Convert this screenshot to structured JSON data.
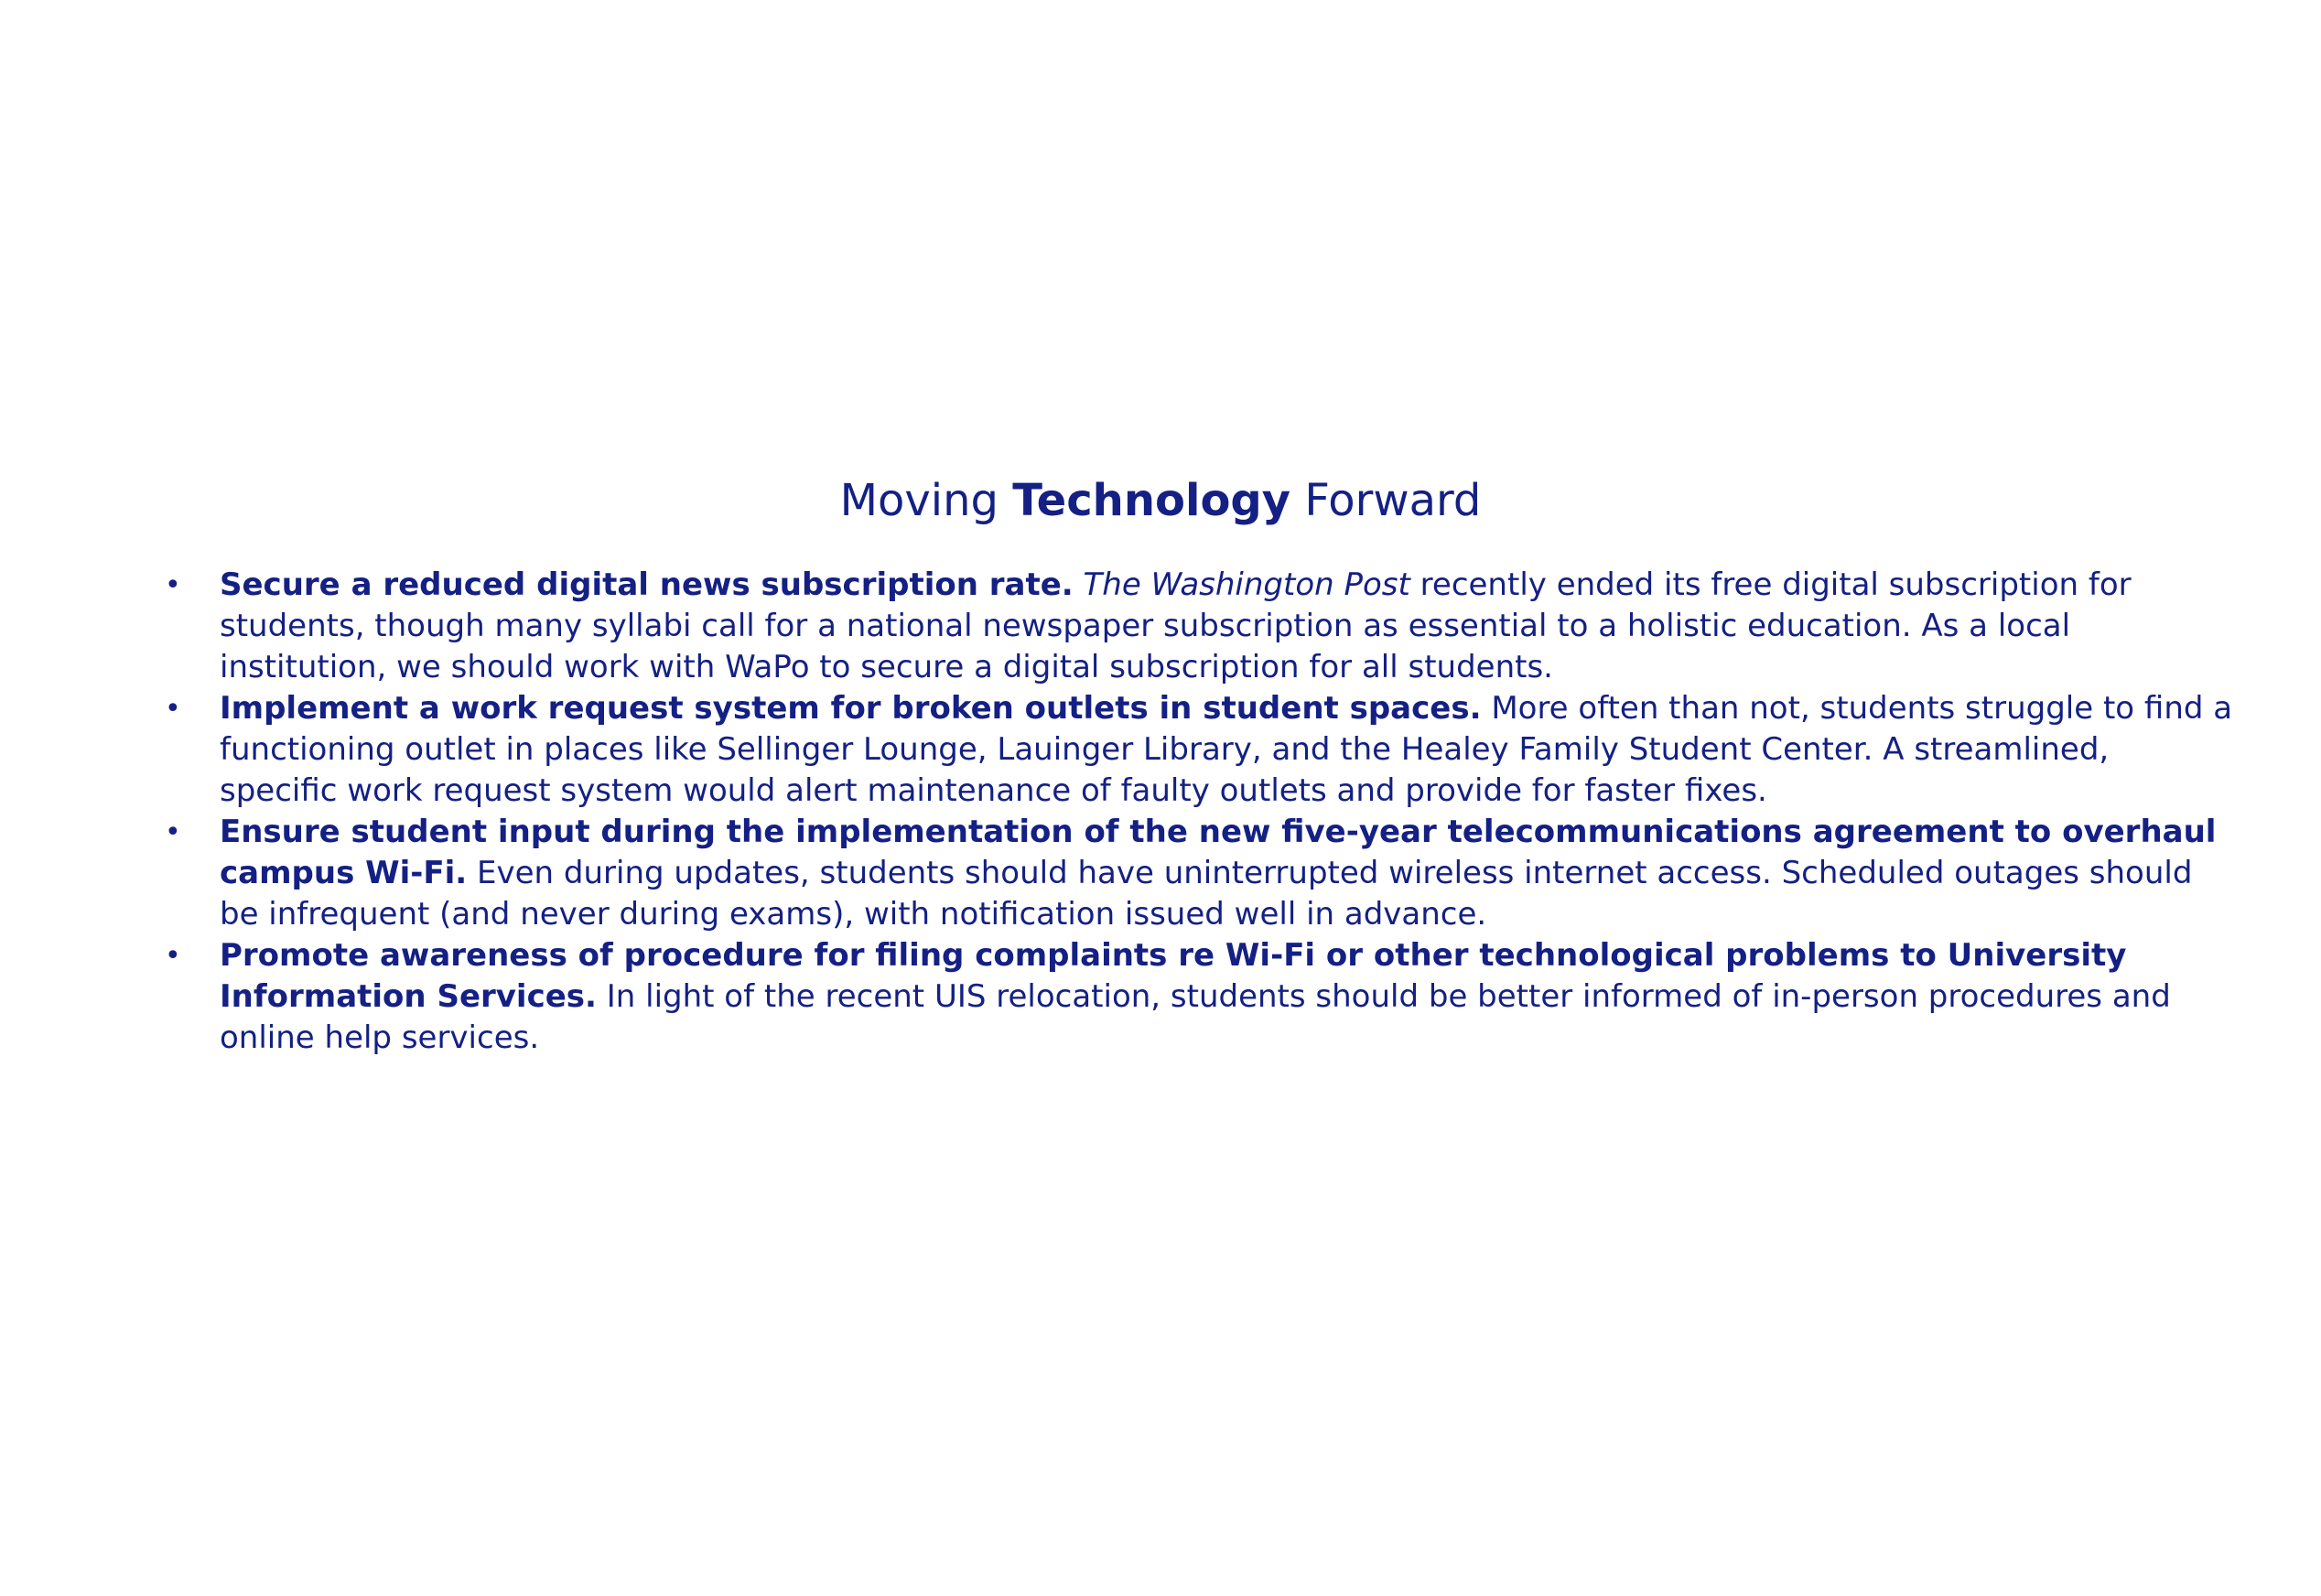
{
  "title": {
    "prefix": "Moving",
    "bold": "Technology",
    "suffix": "Forward"
  },
  "bullets": [
    {
      "heading": "Secure a reduced digital news subscription rate.",
      "italic": "The Washington Post",
      "body": "recently ended its free digital subscription for students, though many syllabi call for a national newspaper subscription as essential to a holistic education. As a local institution, we should work with WaPo to secure a digital subscription for all students."
    },
    {
      "heading": "Implement a work request system for broken outlets in student spaces.",
      "body": "More often than not, students struggle to find a functioning outlet in places like Sellinger Lounge, Lauinger Library, and the Healey Family Student Center. A streamlined, specific work request system would alert maintenance of faulty outlets and provide for faster fixes."
    },
    {
      "heading": "Ensure student input during the implementation of the new five-year telecommunications agreement to overhaul campus Wi-Fi.",
      "body": "Even during updates, students should have uninterrupted wireless internet access. Scheduled outages should be infrequent (and never during exams), with notification issued well in advance."
    },
    {
      "heading": "Promote awareness of procedure for filing complaints re Wi-Fi or other technological problems to University Information Services.",
      "body": "In light of the recent UIS relocation, students should be better informed of in-person procedures and online help services."
    }
  ]
}
